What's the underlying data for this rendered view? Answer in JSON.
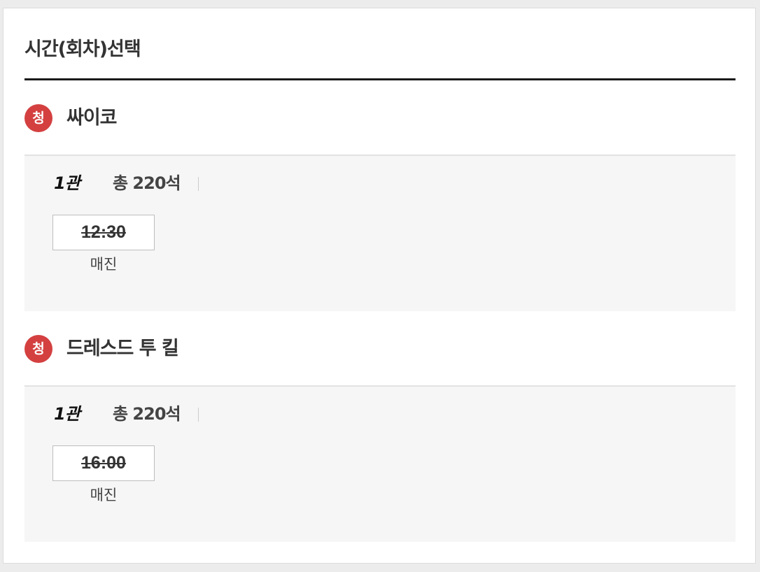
{
  "page": {
    "title": "시간(회차)선택"
  },
  "colors": {
    "rating_badge": "#d44040",
    "screen_bg": "#f6f6f6",
    "rule": "#1a1a1a"
  },
  "movies": [
    {
      "rating": "청",
      "title": "싸이코",
      "screens": [
        {
          "hall": "1관",
          "seats_label": "총 220석",
          "showtimes": [
            {
              "time": "12:30",
              "status": "매진"
            }
          ]
        }
      ]
    },
    {
      "rating": "청",
      "title": "드레스드 투 킬",
      "screens": [
        {
          "hall": "1관",
          "seats_label": "총 220석",
          "showtimes": [
            {
              "time": "16:00",
              "status": "매진"
            }
          ]
        }
      ]
    }
  ]
}
